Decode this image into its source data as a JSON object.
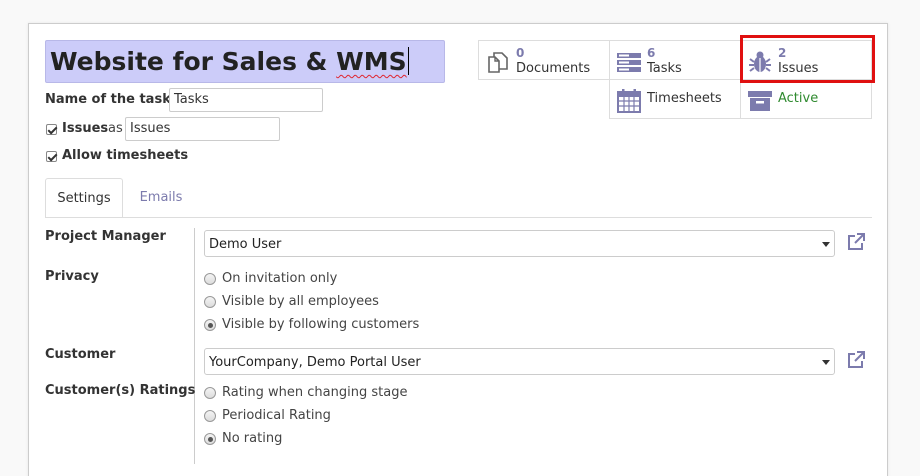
{
  "title": {
    "part1": "Website for Sales & ",
    "part2": "WMS"
  },
  "tasks_name": {
    "label": "Name of the tasks :",
    "value": "Tasks"
  },
  "issues": {
    "label": "Issues",
    "as_label": "as",
    "value": "Issues"
  },
  "timesheets": {
    "label": "Allow timesheets"
  },
  "smart_buttons": {
    "documents": {
      "count": "0",
      "label": "Documents"
    },
    "tasks": {
      "count": "6",
      "label": "Tasks"
    },
    "issues": {
      "count": "2",
      "label": "Issues"
    },
    "timesheets": {
      "label": "Timesheets"
    },
    "active": {
      "label": "Active"
    }
  },
  "tabs": {
    "settings": "Settings",
    "emails": "Emails"
  },
  "form": {
    "project_manager": {
      "label": "Project Manager",
      "value": "Demo User"
    },
    "privacy": {
      "label": "Privacy",
      "options": [
        "On invitation only",
        "Visible by all employees",
        "Visible by following customers"
      ],
      "selected": 2
    },
    "customer": {
      "label": "Customer",
      "value": "YourCompany, Demo Portal User"
    },
    "ratings": {
      "label": "Customer(s) Ratings",
      "options": [
        "Rating when changing stage",
        "Periodical Rating",
        "No rating"
      ],
      "selected": 2
    }
  },
  "colors": {
    "accent": "#7c7bad",
    "active_green": "#2f8a2f",
    "highlight_red": "#e01010",
    "title_bg": "#ccccf9"
  },
  "icons": [
    "documents-icon",
    "tasks-icon",
    "bug-icon",
    "calendar-icon",
    "archive-icon",
    "external-link-icon"
  ]
}
